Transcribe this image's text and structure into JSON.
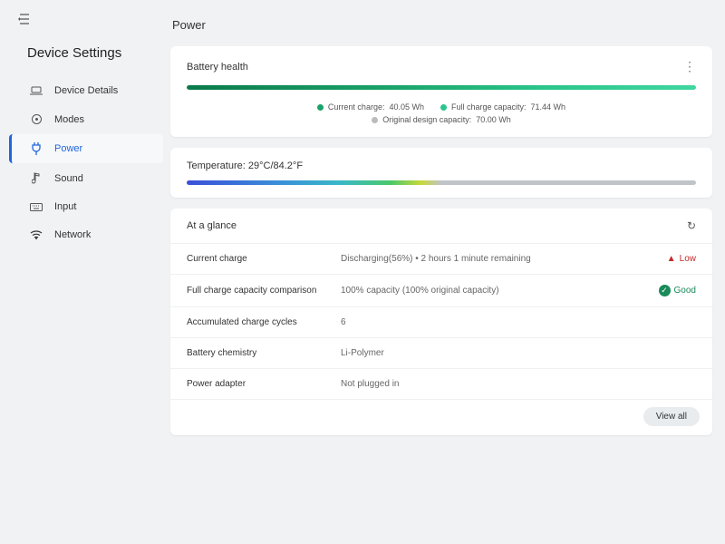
{
  "sidebar": {
    "title": "Device Settings",
    "items": [
      {
        "label": "Device Details",
        "icon": "laptop-icon"
      },
      {
        "label": "Modes",
        "icon": "target-icon"
      },
      {
        "label": "Power",
        "icon": "plug-icon"
      },
      {
        "label": "Sound",
        "icon": "note-icon"
      },
      {
        "label": "Input",
        "icon": "keyboard-icon"
      },
      {
        "label": "Network",
        "icon": "wifi-icon"
      }
    ],
    "active_index": 2
  },
  "page": {
    "title": "Power"
  },
  "battery_health": {
    "title": "Battery health",
    "current_charge_label": "Current charge:",
    "current_charge_value": "40.05 Wh",
    "full_capacity_label": "Full charge capacity:",
    "full_capacity_value": "71.44 Wh",
    "design_capacity_label": "Original design capacity:",
    "design_capacity_value": "70.00 Wh"
  },
  "temperature": {
    "label": "Temperature:",
    "value": "29°C/84.2°F"
  },
  "glance": {
    "title": "At a glance",
    "rows": [
      {
        "label": "Current charge",
        "value": "Discharging(56%)  •  2 hours 1 minute remaining",
        "status": "Low",
        "status_kind": "low"
      },
      {
        "label": "Full charge capacity comparison",
        "value": "100% capacity (100% original capacity)",
        "status": "Good",
        "status_kind": "good"
      },
      {
        "label": "Accumulated charge cycles",
        "value": "6"
      },
      {
        "label": "Battery chemistry",
        "value": "Li-Polymer"
      },
      {
        "label": "Power adapter",
        "value": "Not plugged in"
      }
    ],
    "view_all": "View all"
  }
}
